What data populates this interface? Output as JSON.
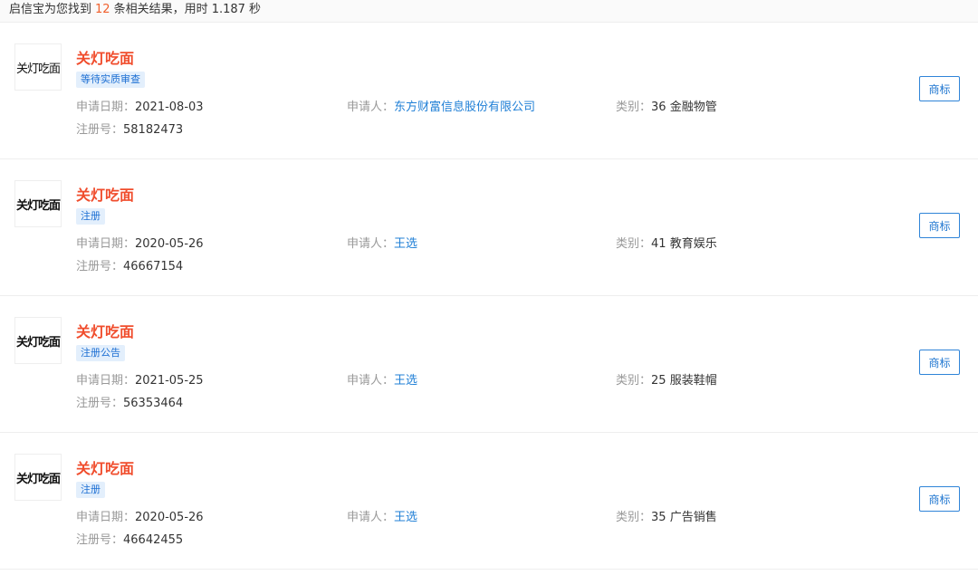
{
  "summary": {
    "prefix": "启信宝为您找到",
    "count": "12",
    "suffix": "条相关结果，用时 1.187 秒"
  },
  "labels": {
    "date": "申请日期：",
    "applicant": "申请人：",
    "category": "类别：",
    "reg_no": "注册号："
  },
  "results": [
    {
      "logo_text": "关灯吃面",
      "title": "关灯吃面",
      "status": "等待实质审查",
      "date": "2021-08-03",
      "applicant": "东方财富信息股份有限公司",
      "category": "36 金融物管",
      "reg_no": "58182473",
      "button": "商标"
    },
    {
      "logo_text": "关灯吃面",
      "title": "关灯吃面",
      "status": "注册",
      "date": "2020-05-26",
      "applicant": "王选",
      "category": "41 教育娱乐",
      "reg_no": "46667154",
      "button": "商标"
    },
    {
      "logo_text": "关灯吃面",
      "title": "关灯吃面",
      "status": "注册公告",
      "date": "2021-05-25",
      "applicant": "王选",
      "category": "25 服装鞋帽",
      "reg_no": "56353464",
      "button": "商标"
    },
    {
      "logo_text": "关灯吃面",
      "title": "关灯吃面",
      "status": "注册",
      "date": "2020-05-26",
      "applicant": "王选",
      "category": "35 广告销售",
      "reg_no": "46642455",
      "button": "商标"
    }
  ]
}
